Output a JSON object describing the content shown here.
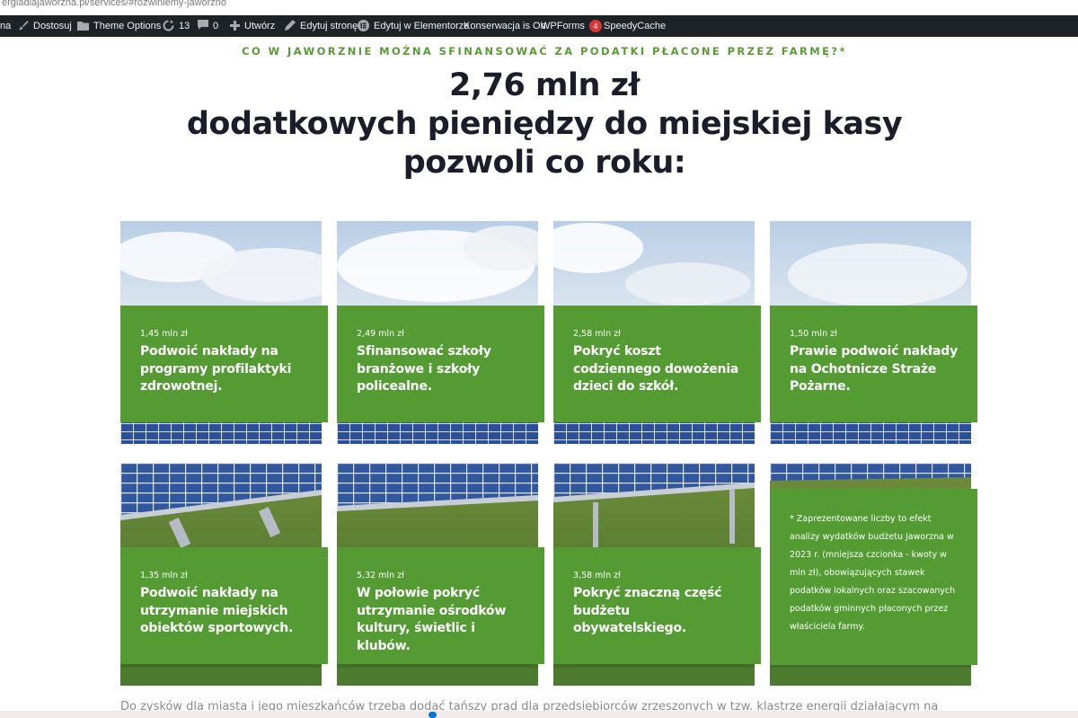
{
  "browser": {
    "url": "ergiadlajaworzna.pl/services/#rozwiniemy-jaworzno"
  },
  "admin_bar": {
    "items": [
      {
        "label": "na",
        "icon": ""
      },
      {
        "label": "Dostosuj",
        "icon": "brush-icon"
      },
      {
        "label": "Theme Options",
        "icon": "folder-icon"
      },
      {
        "label": "13",
        "icon": "update-icon"
      },
      {
        "label": "0",
        "icon": "comment-icon"
      },
      {
        "label": "Utwórz",
        "icon": "plus-icon"
      },
      {
        "label": "Edytuj stronę",
        "icon": "pencil-icon"
      },
      {
        "label": "Edytuj w Elementorze",
        "icon": "elementor-icon"
      },
      {
        "label": "Konserwacja is On",
        "icon": ""
      },
      {
        "label": "WPForms",
        "icon": "",
        "badge": "4"
      },
      {
        "label": "SpeedyCache",
        "icon": ""
      }
    ]
  },
  "hero": {
    "eyebrow": "CO W JAWORZNIE MOŻNA SFINANSOWAĆ ZA PODATKI PŁACONE PRZEZ FARMĘ?*",
    "line1": "2,76 mln zł",
    "line2": "dodatkowych pieniędzy do miejskiej kasy",
    "line3": "pozwoli co roku:"
  },
  "cards": [
    {
      "amount": "1,45 mln zł",
      "title": "Podwoić nakłady na programy profilaktyki zdrowotnej."
    },
    {
      "amount": "2,49 mln zł",
      "title": "Sfinansować szkoły branżowe i szkoły policealne."
    },
    {
      "amount": "2,58 mln zł",
      "title": "Pokryć koszt codziennego dowożenia dzieci do szkół."
    },
    {
      "amount": "1,50 mln zł",
      "title": "Prawie podwoić nakłady na Ochotnicze Straże Pożarne."
    },
    {
      "amount": "1,35 mln zł",
      "title": "Podwoić nakłady na utrzymanie miejskich obiektów sportowych."
    },
    {
      "amount": "5,32 mln zł",
      "title": "W połowie pokryć utrzymanie ośrodków kultury, świetlic i klubów."
    },
    {
      "amount": "3,58 mln zł",
      "title": "Pokryć znaczną część budżetu obywatelskiego."
    }
  ],
  "note": "* Zaprezentowane liczby to efekt analizy wydatków budżetu Jaworzna w 2023 r. (mniejsza czcionka - kwoty w mln zł), obowiązujących stawek podatków lokalnych oraz szacowanych podatków gminnych płaconych przez właściciela farmy.",
  "footer": {
    "text": "Do zysków dla miasta i jego mieszkańców trzeba dodać tańszy prąd dla przedsiębiorców zrzeszonych w tzw. klastrze energii działającym na"
  },
  "colors": {
    "accent_green": "#539b32",
    "eyebrow_green": "#5a9a35",
    "heading": "#1c1c2a",
    "admin_bar": "#1d2327"
  }
}
